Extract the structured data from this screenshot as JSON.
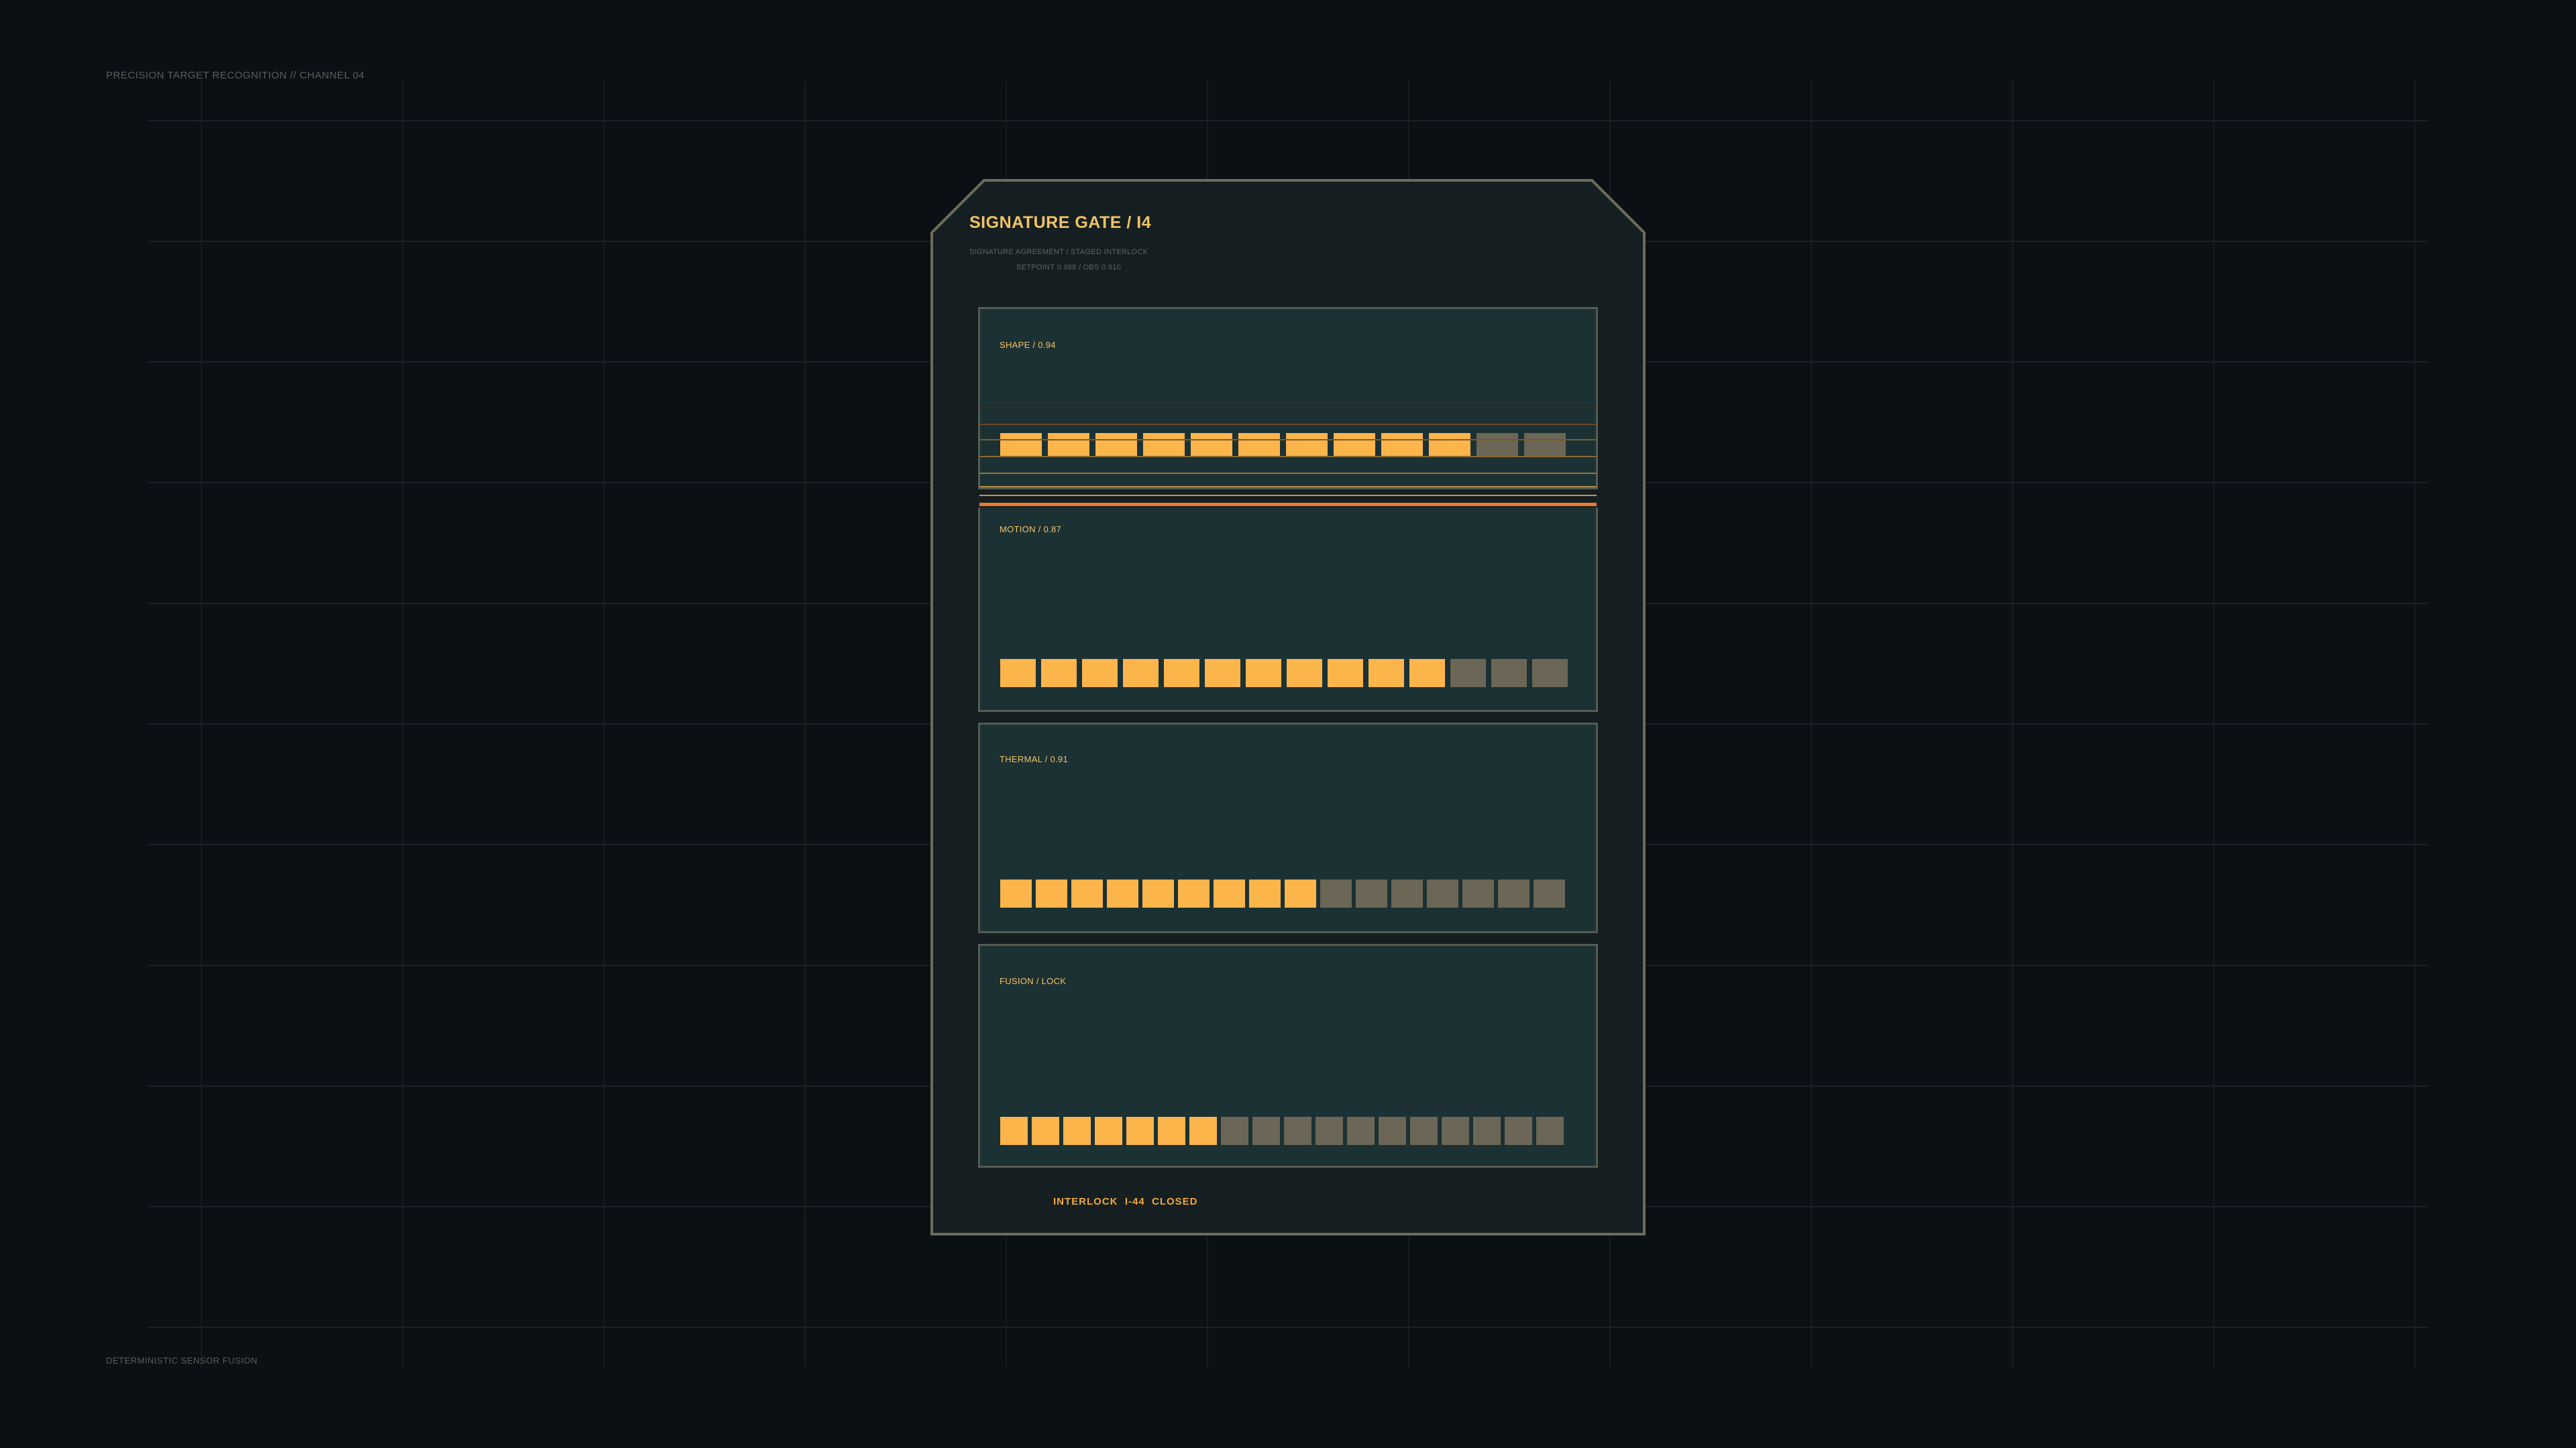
{
  "header": {
    "channel_label": "PRECISION TARGET RECOGNITION // CHANNEL 04"
  },
  "footer": {
    "fusion_label": "DETERMINISTIC SENSOR FUSION"
  },
  "gate": {
    "title": "SIGNATURE GATE / I4",
    "subtitle": "SIGNATURE AGREEMENT / STAGED INTERLOCK",
    "setpoint": "SETPOINT 0.988  /  OBS 0.910",
    "status": "INTERLOCK  I-44  CLOSED"
  },
  "panels": [
    {
      "label": "SHAPE / 0.94",
      "segments_total": 12,
      "segments_on": 10
    },
    {
      "label": "MOTION / 0.87",
      "segments_total": 14,
      "segments_on": 11
    },
    {
      "label": "THERMAL / 0.91",
      "segments_total": 16,
      "segments_on": 9
    },
    {
      "label": "FUSION / LOCK",
      "segments_total": 18,
      "segments_on": 7
    }
  ],
  "colors": {
    "segment_on": "#fbb54b",
    "segment_off": "#6b6655",
    "accent": "#f2c265",
    "alert_line": "#f07b2a"
  }
}
